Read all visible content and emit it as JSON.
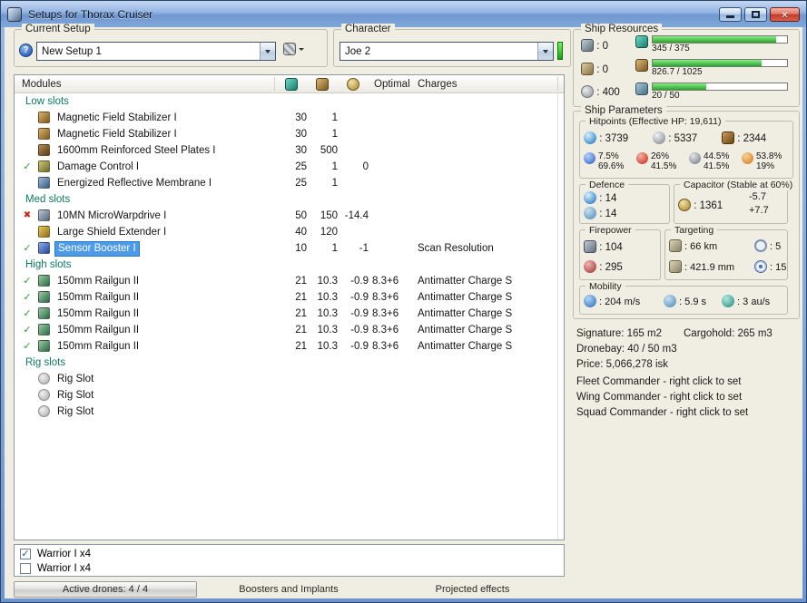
{
  "titlebar": {
    "title": "Setups for Thorax Cruiser"
  },
  "setup": {
    "label": "Current Setup",
    "value": "New Setup 1"
  },
  "character": {
    "label": "Character",
    "value": "Joe 2"
  },
  "table": {
    "modules_header": "Modules",
    "optimal_header": "Optimal",
    "charges_header": "Charges"
  },
  "slots": [
    {
      "label": "Low slots",
      "rows": [
        {
          "status": "",
          "icon": "magnetic-field-stabilizer",
          "name": "Magnetic Field Stabilizer I",
          "cpu": "30",
          "pg": "1",
          "cap": "",
          "optimal": "",
          "charges": ""
        },
        {
          "status": "",
          "icon": "magnetic-field-stabilizer",
          "name": "Magnetic Field Stabilizer I",
          "cpu": "30",
          "pg": "1",
          "cap": "",
          "optimal": "",
          "charges": ""
        },
        {
          "status": "",
          "icon": "steel-plates",
          "name": "1600mm Reinforced Steel Plates I",
          "cpu": "30",
          "pg": "500",
          "cap": "",
          "optimal": "",
          "charges": ""
        },
        {
          "status": "ok",
          "icon": "damage-control",
          "name": "Damage Control I",
          "cpu": "25",
          "pg": "1",
          "cap": "0",
          "optimal": "",
          "charges": ""
        },
        {
          "status": "",
          "icon": "reflective-membrane",
          "name": "Energized Reflective Membrane I",
          "cpu": "25",
          "pg": "1",
          "cap": "",
          "optimal": "",
          "charges": ""
        }
      ]
    },
    {
      "label": "Med slots",
      "rows": [
        {
          "status": "err",
          "icon": "microwarpdrive",
          "name": "10MN MicroWarpdrive I",
          "cpu": "50",
          "pg": "150",
          "cap": "-14.4",
          "optimal": "",
          "charges": ""
        },
        {
          "status": "",
          "icon": "shield-extender",
          "name": "Large Shield Extender I",
          "cpu": "40",
          "pg": "120",
          "cap": "",
          "optimal": "",
          "charges": ""
        },
        {
          "status": "ok",
          "icon": "sensor-booster",
          "name": "Sensor Booster I",
          "selected": true,
          "cpu": "10",
          "pg": "1",
          "cap": "-1",
          "optimal": "",
          "charges": "Scan Resolution"
        }
      ]
    },
    {
      "label": "High slots",
      "rows": [
        {
          "status": "ok",
          "icon": "railgun",
          "name": "150mm Railgun II",
          "cpu": "21",
          "pg": "10.3",
          "cap": "-0.9",
          "optimal": "8.3+6",
          "charges": "Antimatter Charge S"
        },
        {
          "status": "ok",
          "icon": "railgun",
          "name": "150mm Railgun II",
          "cpu": "21",
          "pg": "10.3",
          "cap": "-0.9",
          "optimal": "8.3+6",
          "charges": "Antimatter Charge S"
        },
        {
          "status": "ok",
          "icon": "railgun",
          "name": "150mm Railgun II",
          "cpu": "21",
          "pg": "10.3",
          "cap": "-0.9",
          "optimal": "8.3+6",
          "charges": "Antimatter Charge S"
        },
        {
          "status": "ok",
          "icon": "railgun",
          "name": "150mm Railgun II",
          "cpu": "21",
          "pg": "10.3",
          "cap": "-0.9",
          "optimal": "8.3+6",
          "charges": "Antimatter Charge S"
        },
        {
          "status": "ok",
          "icon": "railgun",
          "name": "150mm Railgun II",
          "cpu": "21",
          "pg": "10.3",
          "cap": "-0.9",
          "optimal": "8.3+6",
          "charges": "Antimatter Charge S"
        }
      ]
    },
    {
      "label": "Rig slots",
      "rows": [
        {
          "status": "",
          "icon": "rig-slot",
          "name": "Rig Slot",
          "cpu": "",
          "pg": "",
          "cap": "",
          "optimal": "",
          "charges": ""
        },
        {
          "status": "",
          "icon": "rig-slot",
          "name": "Rig Slot",
          "cpu": "",
          "pg": "",
          "cap": "",
          "optimal": "",
          "charges": ""
        },
        {
          "status": "",
          "icon": "rig-slot",
          "name": "Rig Slot",
          "cpu": "",
          "pg": "",
          "cap": "",
          "optimal": "",
          "charges": ""
        }
      ]
    }
  ],
  "drones": [
    {
      "checked": true,
      "label": "Warrior I x4"
    },
    {
      "checked": false,
      "label": "Warrior I x4"
    }
  ],
  "bottom": {
    "active_drones": "Active drones: 4 / 4",
    "boosters": "Boosters and Implants",
    "projected": "Projected effects"
  },
  "resources": {
    "label": "Ship Resources",
    "turrets": "0",
    "launchers": "0",
    "calibration": "400",
    "cpu": {
      "text": "345 / 375",
      "pct": 92
    },
    "powergrid": {
      "text": "826.7 / 1025",
      "pct": 81
    },
    "dronebay": {
      "text": "20 / 50",
      "pct": 40
    }
  },
  "parameters": {
    "label": "Ship Parameters",
    "hitpoints": {
      "label": "Hitpoints (Effective HP: 19,611)",
      "shield": "3739",
      "armor": "5337",
      "structure": "2344",
      "resists": [
        {
          "shield": "7.5%",
          "armor": "69.6%"
        },
        {
          "shield": "26%",
          "armor": "41.5%"
        },
        {
          "shield": "44.5%",
          "armor": "41.5%"
        },
        {
          "shield": "53.8%",
          "armor": "19%"
        }
      ]
    },
    "defence": {
      "label": "Defence",
      "row1": "14",
      "row2": "14"
    },
    "capacitor": {
      "label": "Capacitor (Stable at 60%)",
      "capacity": "1361",
      "drain": "-5.7",
      "peak": "+7.7"
    },
    "firepower": {
      "label": "Firepower",
      "dps": "104",
      "volley": "295"
    },
    "targeting": {
      "label": "Targeting",
      "range": "66 km",
      "max_targets": "5",
      "scan_resolution": "421.9 mm",
      "sensor_strength": "15"
    },
    "mobility": {
      "label": "Mobility",
      "speed": "204 m/s",
      "align_time": "5.9 s",
      "warp_speed": "3 au/s"
    },
    "info": {
      "signature": "Signature: 165 m2",
      "cargohold": "Cargohold: 265 m3",
      "dronebay": "Dronebay: 40 / 50 m3",
      "price": "Price: 5,066,278 isk",
      "fleet": "Fleet Commander - right click to set",
      "wing": "Wing Commander - right click to set",
      "squad": "Squad Commander - right click to set"
    }
  }
}
